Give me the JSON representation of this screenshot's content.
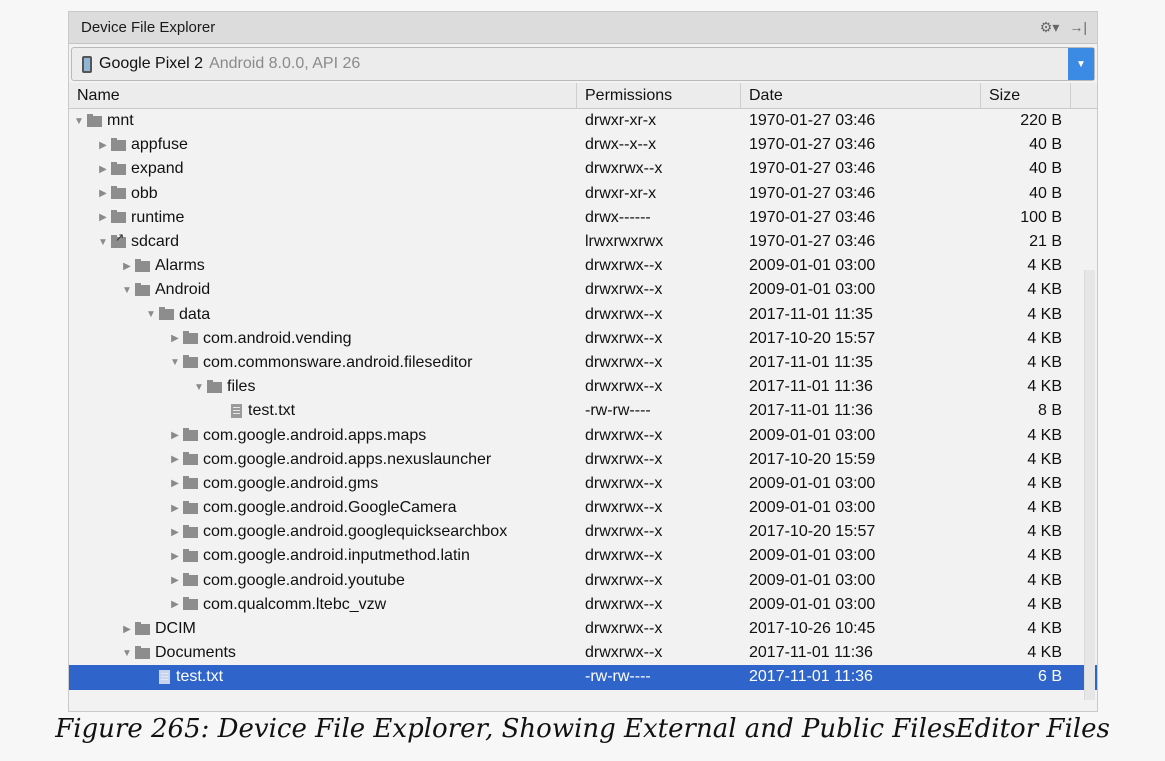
{
  "panel": {
    "title": "Device File Explorer",
    "tools": {
      "settings_icon": "gear-icon",
      "hide_icon": "hide-panel-icon",
      "settings_glyph": "⚙▾",
      "hide_glyph": "→|"
    }
  },
  "device": {
    "name": "Google Pixel 2",
    "version": "Android 8.0.0, API 26",
    "dropdown_glyph": "▼"
  },
  "columns": [
    "Name",
    "Permissions",
    "Date",
    "Size"
  ],
  "rows": [
    {
      "indent": 0,
      "arrow": "▼",
      "type": "folder",
      "name": "mnt",
      "perm": "drwxr-xr-x",
      "date": "1970-01-27 03:46",
      "size": "220 B"
    },
    {
      "indent": 1,
      "arrow": "▶",
      "type": "folder",
      "name": "appfuse",
      "perm": "drwx--x--x",
      "date": "1970-01-27 03:46",
      "size": "40 B"
    },
    {
      "indent": 1,
      "arrow": "▶",
      "type": "folder",
      "name": "expand",
      "perm": "drwxrwx--x",
      "date": "1970-01-27 03:46",
      "size": "40 B"
    },
    {
      "indent": 1,
      "arrow": "▶",
      "type": "folder",
      "name": "obb",
      "perm": "drwxr-xr-x",
      "date": "1970-01-27 03:46",
      "size": "40 B"
    },
    {
      "indent": 1,
      "arrow": "▶",
      "type": "folder",
      "name": "runtime",
      "perm": "drwx------",
      "date": "1970-01-27 03:46",
      "size": "100 B"
    },
    {
      "indent": 1,
      "arrow": "▼",
      "type": "link",
      "name": "sdcard",
      "perm": "lrwxrwxrwx",
      "date": "1970-01-27 03:46",
      "size": "21 B"
    },
    {
      "indent": 2,
      "arrow": "▶",
      "type": "folder",
      "name": "Alarms",
      "perm": "drwxrwx--x",
      "date": "2009-01-01 03:00",
      "size": "4 KB"
    },
    {
      "indent": 2,
      "arrow": "▼",
      "type": "folder",
      "name": "Android",
      "perm": "drwxrwx--x",
      "date": "2009-01-01 03:00",
      "size": "4 KB"
    },
    {
      "indent": 3,
      "arrow": "▼",
      "type": "folder",
      "name": "data",
      "perm": "drwxrwx--x",
      "date": "2017-11-01 11:35",
      "size": "4 KB"
    },
    {
      "indent": 4,
      "arrow": "▶",
      "type": "folder",
      "name": "com.android.vending",
      "perm": "drwxrwx--x",
      "date": "2017-10-20 15:57",
      "size": "4 KB"
    },
    {
      "indent": 4,
      "arrow": "▼",
      "type": "folder",
      "name": "com.commonsware.android.fileseditor",
      "perm": "drwxrwx--x",
      "date": "2017-11-01 11:35",
      "size": "4 KB"
    },
    {
      "indent": 5,
      "arrow": "▼",
      "type": "folder",
      "name": "files",
      "perm": "drwxrwx--x",
      "date": "2017-11-01 11:36",
      "size": "4 KB"
    },
    {
      "indent": 6,
      "arrow": "",
      "type": "file",
      "name": "test.txt",
      "perm": "-rw-rw----",
      "date": "2017-11-01 11:36",
      "size": "8 B"
    },
    {
      "indent": 4,
      "arrow": "▶",
      "type": "folder",
      "name": "com.google.android.apps.maps",
      "perm": "drwxrwx--x",
      "date": "2009-01-01 03:00",
      "size": "4 KB"
    },
    {
      "indent": 4,
      "arrow": "▶",
      "type": "folder",
      "name": "com.google.android.apps.nexuslauncher",
      "perm": "drwxrwx--x",
      "date": "2017-10-20 15:59",
      "size": "4 KB"
    },
    {
      "indent": 4,
      "arrow": "▶",
      "type": "folder",
      "name": "com.google.android.gms",
      "perm": "drwxrwx--x",
      "date": "2009-01-01 03:00",
      "size": "4 KB"
    },
    {
      "indent": 4,
      "arrow": "▶",
      "type": "folder",
      "name": "com.google.android.GoogleCamera",
      "perm": "drwxrwx--x",
      "date": "2009-01-01 03:00",
      "size": "4 KB"
    },
    {
      "indent": 4,
      "arrow": "▶",
      "type": "folder",
      "name": "com.google.android.googlequicksearchbox",
      "perm": "drwxrwx--x",
      "date": "2017-10-20 15:57",
      "size": "4 KB"
    },
    {
      "indent": 4,
      "arrow": "▶",
      "type": "folder",
      "name": "com.google.android.inputmethod.latin",
      "perm": "drwxrwx--x",
      "date": "2009-01-01 03:00",
      "size": "4 KB"
    },
    {
      "indent": 4,
      "arrow": "▶",
      "type": "folder",
      "name": "com.google.android.youtube",
      "perm": "drwxrwx--x",
      "date": "2009-01-01 03:00",
      "size": "4 KB"
    },
    {
      "indent": 4,
      "arrow": "▶",
      "type": "folder",
      "name": "com.qualcomm.ltebc_vzw",
      "perm": "drwxrwx--x",
      "date": "2009-01-01 03:00",
      "size": "4 KB"
    },
    {
      "indent": 2,
      "arrow": "▶",
      "type": "folder",
      "name": "DCIM",
      "perm": "drwxrwx--x",
      "date": "2017-10-26 10:45",
      "size": "4 KB"
    },
    {
      "indent": 2,
      "arrow": "▼",
      "type": "folder",
      "name": "Documents",
      "perm": "drwxrwx--x",
      "date": "2017-11-01 11:36",
      "size": "4 KB"
    },
    {
      "indent": 3,
      "arrow": "",
      "type": "file",
      "name": "test.txt",
      "perm": "-rw-rw----",
      "date": "2017-11-01 11:36",
      "size": "6 B",
      "selected": true
    }
  ],
  "caption": "Figure 265: Device File Explorer, Showing External and Public FilesEditor Files",
  "colors": {
    "selection": "#2f65ca",
    "dropdown": "#3b8be5"
  }
}
